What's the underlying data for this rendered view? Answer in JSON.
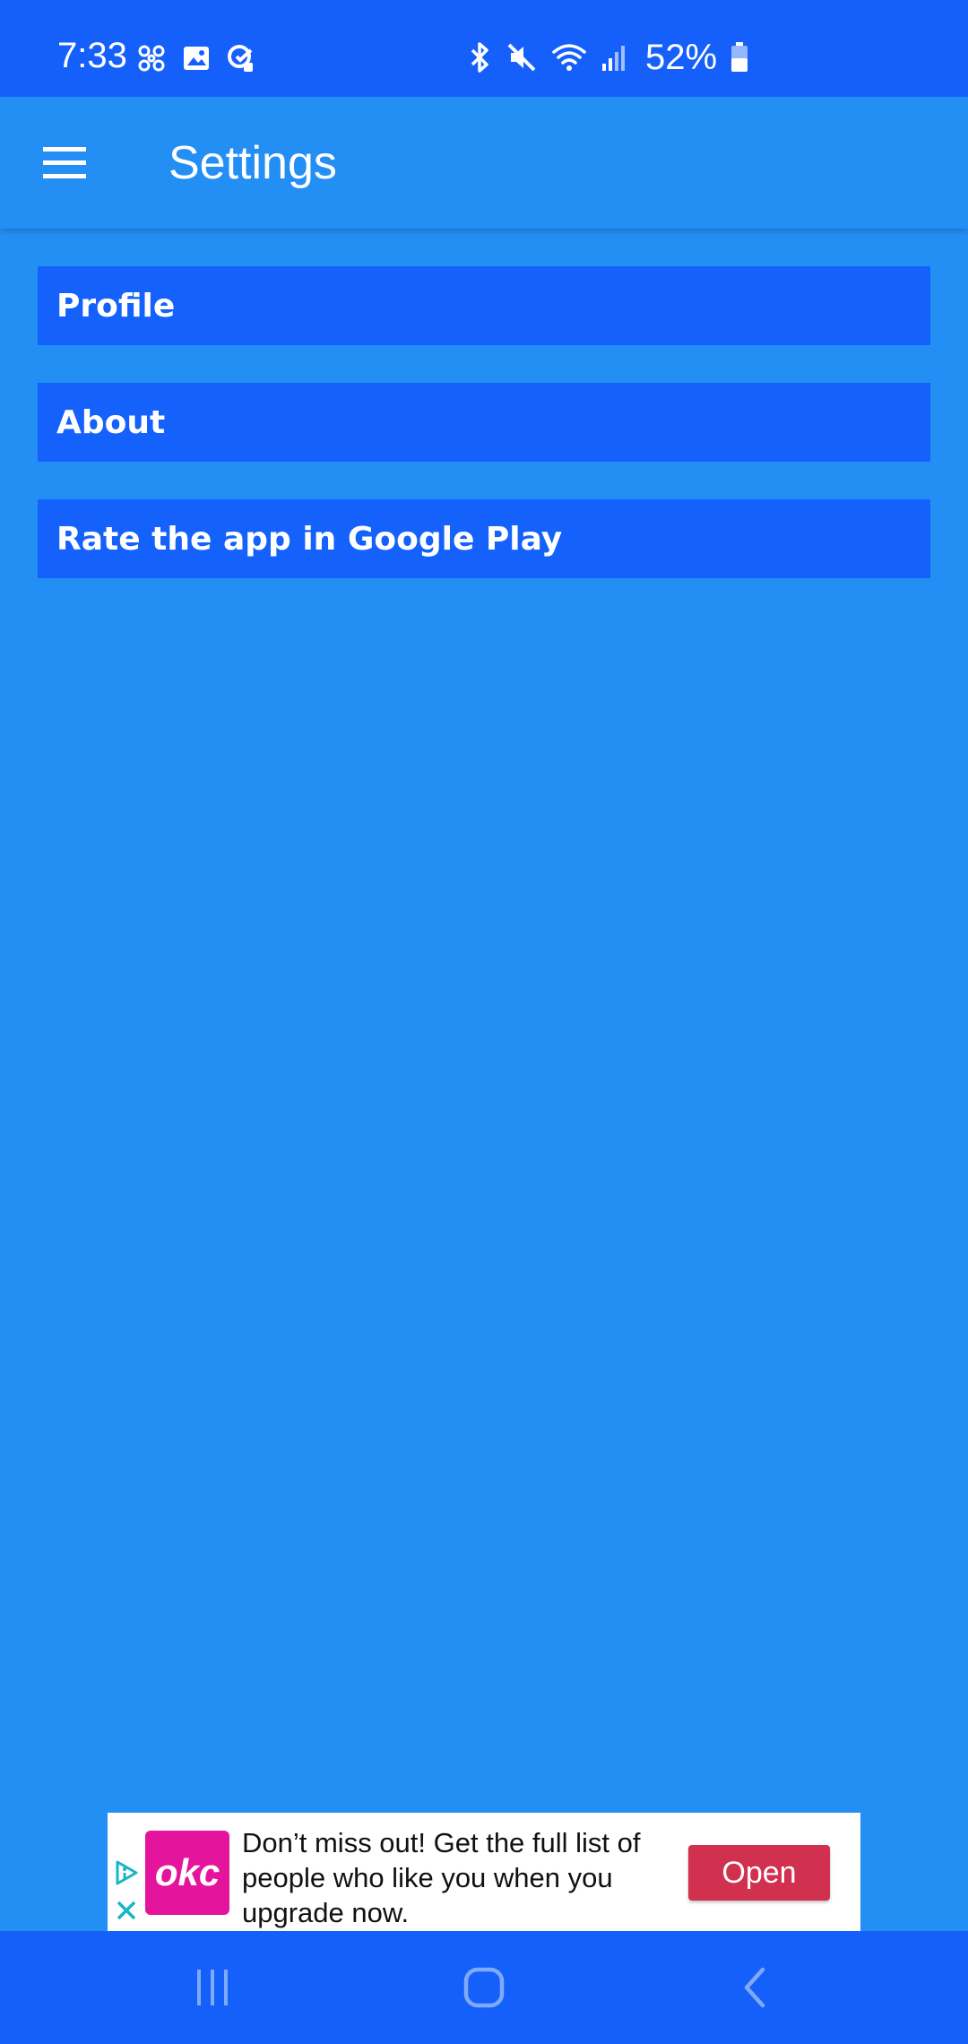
{
  "status_bar": {
    "time": "7:33",
    "battery": "52%",
    "left_icons": [
      "pinwheel-icon",
      "image-icon",
      "sync-badge-icon"
    ],
    "right_icons": [
      "bluetooth-icon",
      "mute-icon",
      "wifi-icon",
      "signal-icon",
      "battery-icon"
    ]
  },
  "app_bar": {
    "title": "Settings",
    "menu_icon": "hamburger-menu-icon"
  },
  "settings": {
    "items": [
      {
        "label": "Profile"
      },
      {
        "label": "About"
      },
      {
        "label": "Rate the app in Google Play"
      }
    ]
  },
  "ad": {
    "brand": "okc",
    "text": "Don’t miss out! Get the full list of people who like you when you upgrade now.",
    "button": "Open",
    "colors": {
      "logo": "#e5149c",
      "button": "#d1314f"
    }
  },
  "nav_bar": {
    "buttons": [
      "recents-icon",
      "home-icon",
      "back-icon"
    ]
  },
  "colors": {
    "background": "#238ff5",
    "status_bar": "#1560fb",
    "list_item": "#1461fb"
  }
}
